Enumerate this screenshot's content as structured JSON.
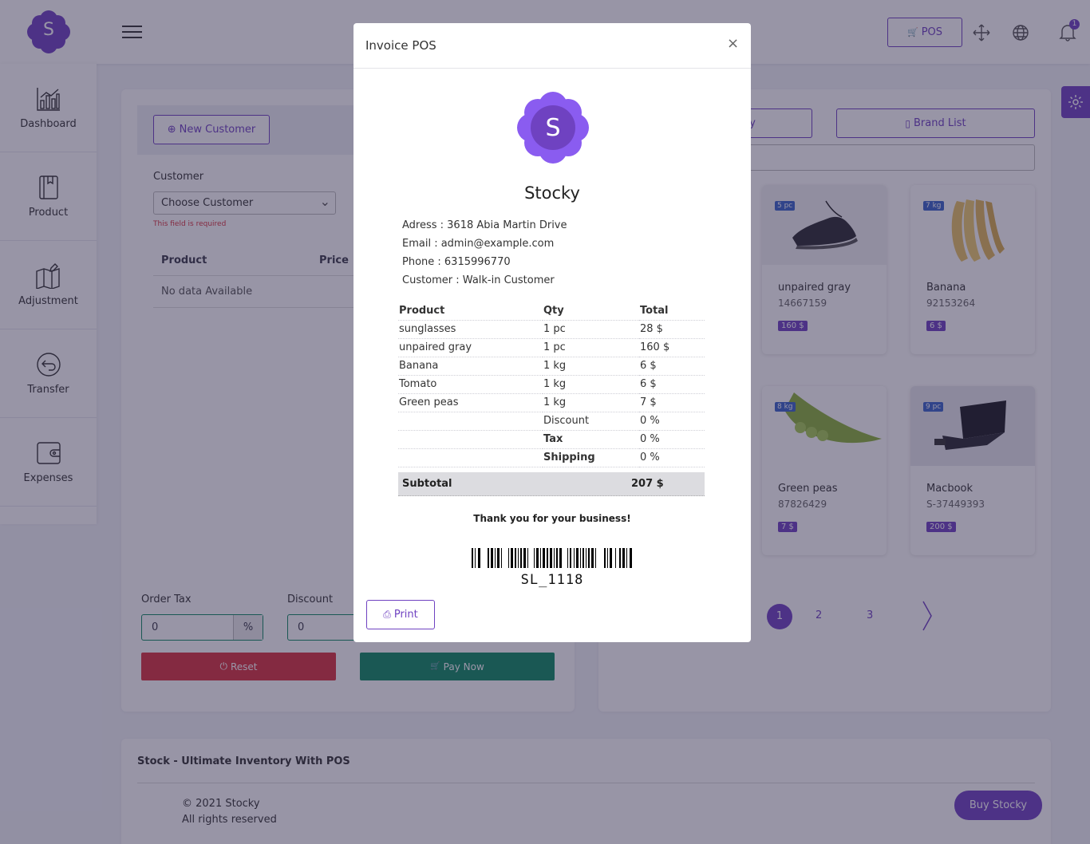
{
  "header": {
    "logo_letter": "S",
    "pos_label": "POS",
    "notification_count": "1"
  },
  "sidebar": {
    "items": [
      {
        "label": "Dashboard",
        "icon": "chart-icon"
      },
      {
        "label": "Product",
        "icon": "book-icon"
      },
      {
        "label": "Adjustment",
        "icon": "map-edit-icon"
      },
      {
        "label": "Transfer",
        "icon": "arrow-back-icon"
      },
      {
        "label": "Expenses",
        "icon": "wallet-icon"
      }
    ]
  },
  "left_panel": {
    "new_customer_label": "New Customer",
    "customer_label": "Customer",
    "customer_select_value": "Choose Customer",
    "customer_error": "This field is required",
    "table_headers": [
      "Product",
      "Price"
    ],
    "no_data": "No data Available",
    "order_tax_label": "Order Tax",
    "order_tax_value": "0",
    "order_tax_unit": "%",
    "discount_label": "Discount",
    "discount_value": "0",
    "reset_label": "Reset",
    "pay_now_label": "Pay Now"
  },
  "right_panel": {
    "category_list_label": "y",
    "brand_list_label": "Brand List",
    "products": [
      {
        "unit": "5 pc",
        "name": "unpaired gray",
        "code": "14667159",
        "price": "160 $"
      },
      {
        "unit": "7 kg",
        "name": "Banana",
        "code": "92153264",
        "price": "6 $"
      },
      {
        "unit": "8 kg",
        "name": "Green peas",
        "code": "87826429",
        "price": "7 $"
      },
      {
        "unit": "9 pc",
        "name": "Macbook",
        "code": "S-37449393",
        "price": "200 $"
      }
    ],
    "pages": [
      "1",
      "2",
      "3"
    ]
  },
  "footer": {
    "title": "Stock - Ultimate Inventory With POS",
    "copyright": "© 2021 Stocky",
    "rights": "All rights reserved",
    "buy_label": "Buy Stocky"
  },
  "modal": {
    "title": "Invoice POS",
    "close_symbol": "×",
    "logo_letter": "S",
    "company_name": "Stocky",
    "address": "Adress : 3618 Abia Martin Drive",
    "email": "Email : admin@example.com",
    "phone": "Phone : 6315996770",
    "customer": "Customer : Walk-in Customer",
    "headers": [
      "Product",
      "Qty",
      "Total"
    ],
    "items": [
      {
        "product": "sunglasses",
        "qty": "1 pc",
        "total": "28 $"
      },
      {
        "product": "unpaired gray",
        "qty": "1 pc",
        "total": "160 $"
      },
      {
        "product": "Banana",
        "qty": "1 kg",
        "total": "6 $"
      },
      {
        "product": "Tomato",
        "qty": "1 kg",
        "total": "6 $"
      },
      {
        "product": "Green peas",
        "qty": "1 kg",
        "total": "7 $"
      }
    ],
    "discount_label": "Discount",
    "discount_value": "0 %",
    "tax_label": "Tax",
    "tax_value": "0 %",
    "shipping_label": "Shipping",
    "shipping_value": "0 %",
    "subtotal_label": "Subtotal",
    "subtotal_value": "207 $",
    "thanks": "Thank you for your business!",
    "barcode_text": "SL_1118",
    "print_label": "Print"
  },
  "colors": {
    "primary": "#6f42c1",
    "danger": "#d9323e",
    "success": "#0f8a63",
    "badge_blue": "#3a65c9"
  }
}
